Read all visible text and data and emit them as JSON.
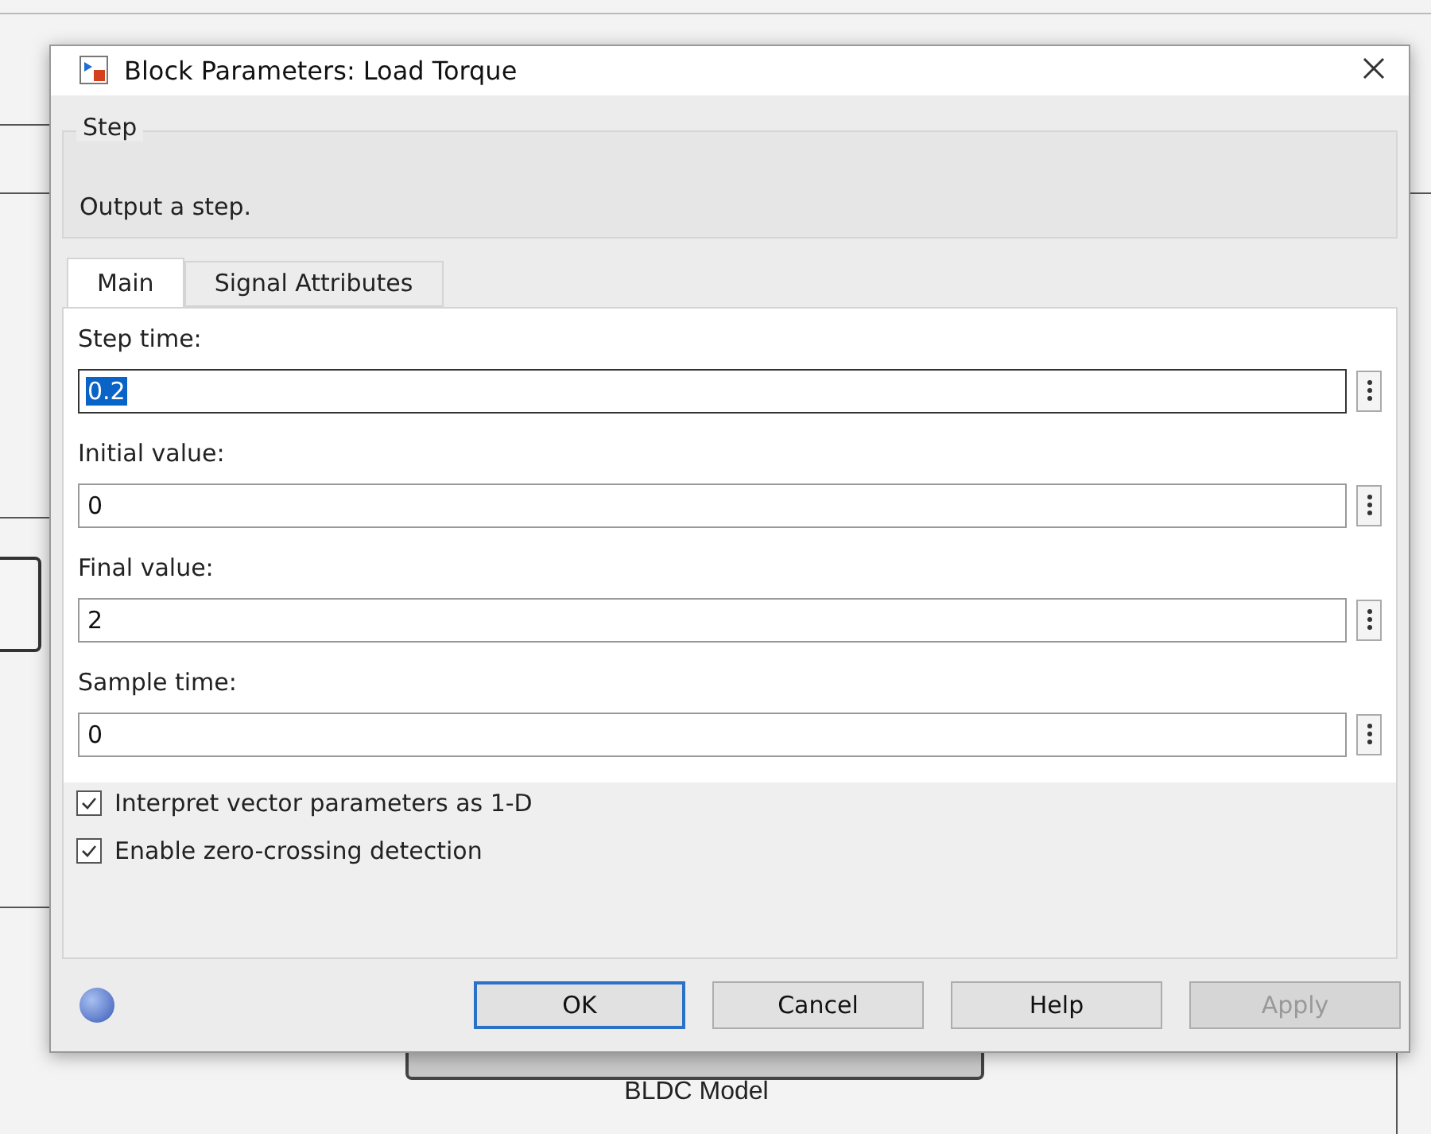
{
  "window": {
    "title": "Block Parameters: Load Torque"
  },
  "description": {
    "group": "Step",
    "text": "Output a step."
  },
  "tabs": [
    {
      "label": "Main",
      "selected": true
    },
    {
      "label": "Signal Attributes",
      "selected": false
    }
  ],
  "parameters": [
    {
      "label": "Step time:",
      "value": "0.2",
      "text_selected": true
    },
    {
      "label": "Initial value:",
      "value": "0",
      "text_selected": false
    },
    {
      "label": "Final value:",
      "value": "2",
      "text_selected": false
    },
    {
      "label": "Sample time:",
      "value": "0",
      "text_selected": false
    }
  ],
  "options": [
    {
      "label": "Interpret vector parameters as 1-D",
      "checked": true
    },
    {
      "label": "Enable zero-crossing detection",
      "checked": true
    }
  ],
  "buttons": [
    {
      "label": "OK",
      "default": true,
      "disabled": false
    },
    {
      "label": "Cancel",
      "default": false,
      "disabled": false
    },
    {
      "label": "Help",
      "default": false,
      "disabled": false
    },
    {
      "label": "Apply",
      "default": false,
      "disabled": true
    }
  ],
  "background": {
    "block_label": "BLDC Model"
  }
}
